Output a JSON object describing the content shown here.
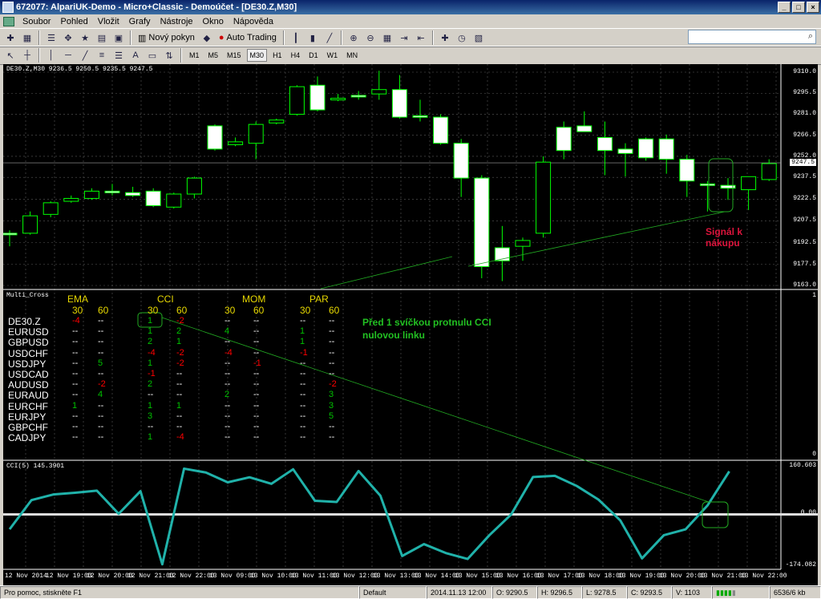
{
  "window": {
    "title": "672077: AlpariUK-Demo - Micro+Classic - Demoúčet - [DE30.Z,M30]"
  },
  "menu": [
    "Soubor",
    "Pohled",
    "Vložit",
    "Grafy",
    "Nástroje",
    "Okno",
    "Nápověda"
  ],
  "toolbar": {
    "new_order": "Nový pokyn",
    "auto_trading": "Auto Trading",
    "timeframes": [
      "M1",
      "M5",
      "M15",
      "M30",
      "H1",
      "H4",
      "D1",
      "W1",
      "MN"
    ],
    "active_timeframe": "M30"
  },
  "chart": {
    "header": "DE30.Z,M30  9236.5 9250.5 9235.5 9247.5",
    "price_ticks": [
      "9310.0",
      "9295.5",
      "9281.0",
      "9266.5",
      "9252.0",
      "9237.5",
      "9222.5",
      "9207.5",
      "9192.5",
      "9177.5",
      "9163.0"
    ],
    "current_price": "9247.5",
    "annotation_buy": "Signál k\nnákupu",
    "annotation_cci": "Před 1 svíčkou protnulu CCI\nnulovou linku",
    "candles": [
      [
        9199,
        9201,
        9190,
        9198
      ],
      [
        9199,
        9214,
        9198,
        9211
      ],
      [
        9212,
        9221,
        9210,
        9220
      ],
      [
        9221,
        9225,
        9220,
        9223
      ],
      [
        9223,
        9230,
        9222,
        9228
      ],
      [
        9228,
        9233,
        9225,
        9227
      ],
      [
        9227,
        9231,
        9224,
        9225
      ],
      [
        9228,
        9230,
        9217,
        9218
      ],
      [
        9217,
        9227,
        9216,
        9226
      ],
      [
        9226,
        9238,
        9223,
        9237
      ],
      [
        9273,
        9274,
        9256,
        9257
      ],
      [
        9260,
        9265,
        9259,
        9262
      ],
      [
        9261,
        9276,
        9250,
        9274
      ],
      [
        9275,
        9278,
        9274,
        9277
      ],
      [
        9281,
        9301,
        9280,
        9300
      ],
      [
        9301,
        9307,
        9283,
        9284
      ],
      [
        9292,
        9295,
        9290,
        9292
      ],
      [
        9294,
        9297,
        9291,
        9293
      ],
      [
        9295,
        9311,
        9291,
        9298
      ],
      [
        9298,
        9308,
        9278,
        9279
      ],
      [
        9280,
        9291,
        9276,
        9279
      ],
      [
        9279,
        9281,
        9260,
        9261
      ],
      [
        9261,
        9264,
        9224,
        9237
      ],
      [
        9237,
        9239,
        9168,
        9176
      ],
      [
        9189,
        9204,
        9166,
        9180
      ],
      [
        9190,
        9196,
        9180,
        9194
      ],
      [
        9199,
        9252,
        9196,
        9248
      ],
      [
        9272,
        9276,
        9250,
        9256
      ],
      [
        9273,
        9283,
        9272,
        9269
      ],
      [
        9265,
        9276,
        9239,
        9256
      ],
      [
        9257,
        9261,
        9238,
        9254
      ],
      [
        9264,
        9265,
        9249,
        9251
      ],
      [
        9264,
        9267,
        9240,
        9250
      ],
      [
        9250,
        9253,
        9224,
        9235
      ],
      [
        9233,
        9235,
        9214,
        9232
      ],
      [
        9232,
        9237,
        9222,
        9230
      ],
      [
        9229,
        9234,
        9215,
        9238
      ],
      [
        9236,
        9250,
        9235,
        9247
      ]
    ]
  },
  "multi_cross": {
    "label": "Multi_Cross",
    "scale_top": "1",
    "scale_bottom": "0",
    "groups": [
      "EMA",
      "CCI",
      "MOM",
      "PAR"
    ],
    "periods": [
      "30",
      "60"
    ],
    "rows": [
      {
        "symbol": "DE30.Z",
        "values": [
          [
            "-4",
            "red"
          ],
          [
            "--",
            "white"
          ],
          [
            "1",
            "green"
          ],
          [
            "-2",
            "red"
          ],
          [
            "--",
            "white"
          ],
          [
            "--",
            "white"
          ],
          [
            "--",
            "white"
          ],
          [
            "--",
            "white"
          ]
        ]
      },
      {
        "symbol": "EURUSD",
        "values": [
          [
            "--",
            "white"
          ],
          [
            "--",
            "white"
          ],
          [
            "1",
            "green"
          ],
          [
            "2",
            "green"
          ],
          [
            "4",
            "green"
          ],
          [
            "--",
            "white"
          ],
          [
            "1",
            "green"
          ],
          [
            "--",
            "white"
          ]
        ]
      },
      {
        "symbol": "GBPUSD",
        "values": [
          [
            "--",
            "white"
          ],
          [
            "--",
            "white"
          ],
          [
            "2",
            "green"
          ],
          [
            "1",
            "green"
          ],
          [
            "--",
            "white"
          ],
          [
            "--",
            "white"
          ],
          [
            "1",
            "green"
          ],
          [
            "--",
            "white"
          ]
        ]
      },
      {
        "symbol": "USDCHF",
        "values": [
          [
            "--",
            "white"
          ],
          [
            "--",
            "white"
          ],
          [
            "-4",
            "red"
          ],
          [
            "-2",
            "red"
          ],
          [
            "-4",
            "red"
          ],
          [
            "--",
            "white"
          ],
          [
            "-1",
            "red"
          ],
          [
            "--",
            "white"
          ]
        ]
      },
      {
        "symbol": "USDJPY",
        "values": [
          [
            "--",
            "white"
          ],
          [
            "5",
            "green"
          ],
          [
            "1",
            "green"
          ],
          [
            "-2",
            "red"
          ],
          [
            "--",
            "white"
          ],
          [
            "-1",
            "red"
          ],
          [
            "--",
            "white"
          ],
          [
            "--",
            "white"
          ]
        ]
      },
      {
        "symbol": "USDCAD",
        "values": [
          [
            "--",
            "white"
          ],
          [
            "--",
            "white"
          ],
          [
            "-1",
            "red"
          ],
          [
            "--",
            "white"
          ],
          [
            "--",
            "white"
          ],
          [
            "--",
            "white"
          ],
          [
            "--",
            "white"
          ],
          [
            "--",
            "white"
          ]
        ]
      },
      {
        "symbol": "AUDUSD",
        "values": [
          [
            "--",
            "white"
          ],
          [
            "-2",
            "red"
          ],
          [
            "2",
            "green"
          ],
          [
            "--",
            "white"
          ],
          [
            "--",
            "white"
          ],
          [
            "--",
            "white"
          ],
          [
            "--",
            "white"
          ],
          [
            "-2",
            "red"
          ]
        ]
      },
      {
        "symbol": "EURAUD",
        "values": [
          [
            "--",
            "white"
          ],
          [
            "4",
            "green"
          ],
          [
            "--",
            "white"
          ],
          [
            "--",
            "white"
          ],
          [
            "2",
            "green"
          ],
          [
            "--",
            "white"
          ],
          [
            "--",
            "white"
          ],
          [
            "3",
            "green"
          ]
        ]
      },
      {
        "symbol": "EURCHF",
        "values": [
          [
            "1",
            "green"
          ],
          [
            "--",
            "white"
          ],
          [
            "1",
            "green"
          ],
          [
            "1",
            "green"
          ],
          [
            "--",
            "white"
          ],
          [
            "--",
            "white"
          ],
          [
            "--",
            "white"
          ],
          [
            "3",
            "green"
          ]
        ]
      },
      {
        "symbol": "EURJPY",
        "values": [
          [
            "--",
            "white"
          ],
          [
            "--",
            "white"
          ],
          [
            "3",
            "green"
          ],
          [
            "--",
            "white"
          ],
          [
            "--",
            "white"
          ],
          [
            "--",
            "white"
          ],
          [
            "--",
            "white"
          ],
          [
            "5",
            "green"
          ]
        ]
      },
      {
        "symbol": "GBPCHF",
        "values": [
          [
            "--",
            "white"
          ],
          [
            "--",
            "white"
          ],
          [
            "--",
            "white"
          ],
          [
            "--",
            "white"
          ],
          [
            "--",
            "white"
          ],
          [
            "--",
            "white"
          ],
          [
            "--",
            "white"
          ],
          [
            "--",
            "white"
          ]
        ]
      },
      {
        "symbol": "CADJPY",
        "values": [
          [
            "--",
            "white"
          ],
          [
            "--",
            "white"
          ],
          [
            "1",
            "green"
          ],
          [
            "-4",
            "red"
          ],
          [
            "--",
            "white"
          ],
          [
            "--",
            "white"
          ],
          [
            "--",
            "white"
          ],
          [
            "--",
            "white"
          ]
        ]
      }
    ]
  },
  "cci": {
    "label": "CCI(5) 145.3901",
    "ticks": [
      "160.603",
      "0.00",
      "-174.082"
    ],
    "values": [
      -50,
      48,
      67,
      73,
      80,
      2,
      78,
      -168,
      154,
      141,
      108,
      125,
      103,
      152,
      46,
      42,
      146,
      63,
      -140,
      -100,
      -130,
      -150,
      -70,
      0,
      126,
      130,
      96,
      50,
      -20,
      -148,
      -70,
      -50,
      30,
      145
    ]
  },
  "dates": [
    "12 Nov 2014",
    "12 Nov 19:00",
    "12 Nov 20:00",
    "12 Nov 21:00",
    "12 Nov 22:00",
    "13 Nov 09:00",
    "13 Nov 10:00",
    "13 Nov 11:00",
    "13 Nov 12:00",
    "13 Nov 13:00",
    "13 Nov 14:00",
    "13 Nov 15:00",
    "13 Nov 16:00",
    "13 Nov 17:00",
    "13 Nov 18:00",
    "13 Nov 19:00",
    "13 Nov 20:00",
    "13 Nov 21:00",
    "13 Nov 22:00"
  ],
  "status": {
    "help": "Pro pomoc, stiskněte F1",
    "profile": "Default",
    "datetime": "2014.11.13 12:00",
    "open": "O: 9290.5",
    "high": "H: 9296.5",
    "low": "L: 9278.5",
    "close": "C: 9293.5",
    "volume": "V: 1103",
    "traffic": "6536/6 kb"
  },
  "colors": {
    "bull": "#00ff00",
    "bear_fill": "#ffffff",
    "cci": "#20b2aa",
    "grid": "#5a5a5a",
    "positive": "#00c000",
    "negative": "#ff0000",
    "annotation_red": "#dc143c",
    "annotation_green": "#22c022"
  }
}
